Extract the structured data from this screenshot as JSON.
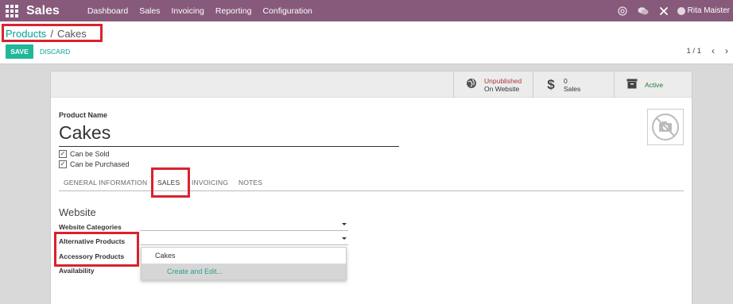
{
  "navbar": {
    "brand": "Sales",
    "menu": [
      "Dashboard",
      "Sales",
      "Invoicing",
      "Reporting",
      "Configuration"
    ],
    "user_name": "Rita Maister"
  },
  "breadcrumb": {
    "parent": "Products",
    "separator": "/",
    "current": "Cakes"
  },
  "buttons": {
    "save": "SAVE",
    "discard": "DISCARD"
  },
  "pager": {
    "value": "1 / 1"
  },
  "stat_buttons": {
    "website_line1": "Unpublished",
    "website_line2": "On Website",
    "sales_count": "0",
    "sales_label": "Sales",
    "active_label": "Active"
  },
  "form": {
    "product_name_label": "Product Name",
    "product_name": "Cakes",
    "can_be_sold": "Can be Sold",
    "can_be_purchased": "Can be Purchased"
  },
  "tabs": [
    "GENERAL INFORMATION",
    "SALES",
    "INVOICING",
    "NOTES"
  ],
  "website_section": {
    "title": "Website",
    "fields": [
      "Website Categories",
      "Alternative Products",
      "Accessory Products",
      "Availability"
    ]
  },
  "dropdown": {
    "option": "Cakes",
    "create_edit": "Create and Edit..."
  },
  "colors": {
    "navbar": "#875a7b",
    "accent": "#00a09d",
    "save_button": "#21b799",
    "highlight_box": "#d9232e"
  }
}
